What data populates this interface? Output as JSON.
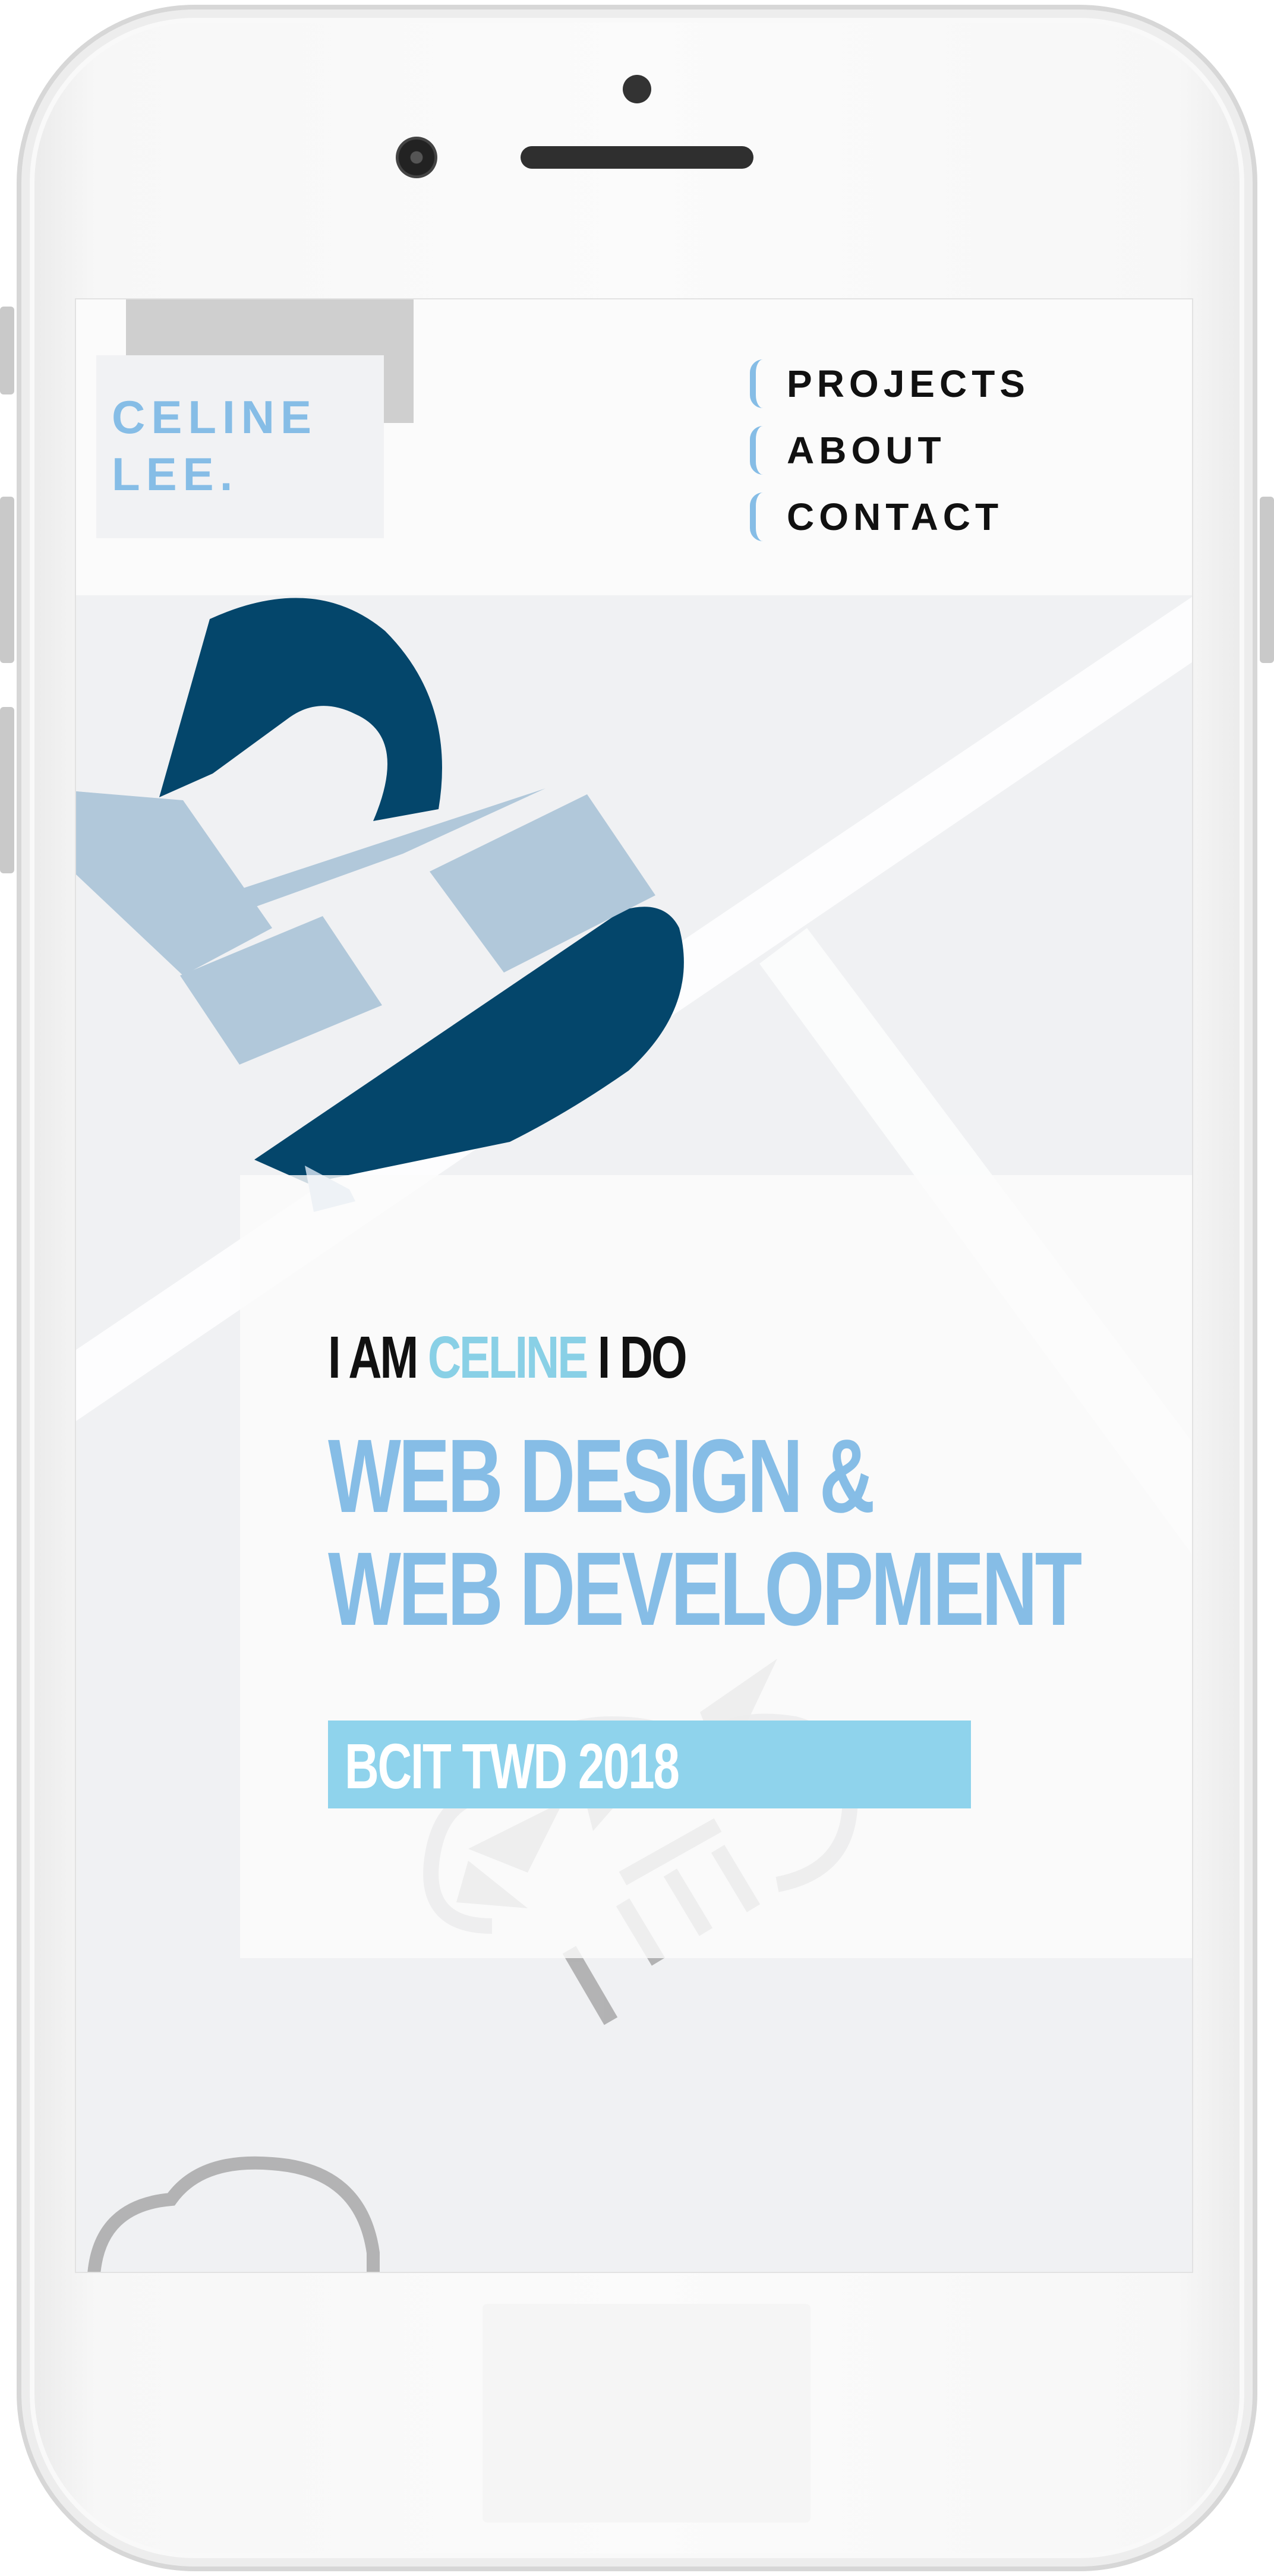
{
  "header": {
    "logo_line1": "CELINE",
    "logo_line2": "LEE.",
    "nav": [
      {
        "label": "PROJECTS"
      },
      {
        "label": "ABOUT"
      },
      {
        "label": "CONTACT"
      }
    ]
  },
  "hero": {
    "prefix": "I AM",
    "name": "CELINE",
    "suffix": "I DO",
    "heading_line1": "WEB DESIGN &",
    "heading_line2": "WEB DEVELOPMENT",
    "badge": "BCIT TWD 2018"
  },
  "colors": {
    "accent_blue": "#86bde6",
    "accent_cyan": "#8fd3ec",
    "dark_blue": "#04466b",
    "light_blue": "#b1c8da",
    "background": "#f0f1f3"
  }
}
